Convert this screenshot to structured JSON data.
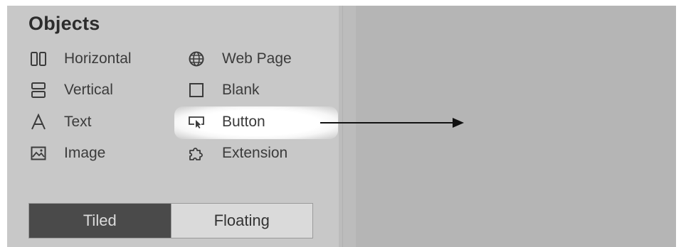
{
  "objects_panel": {
    "title": "Objects",
    "items": [
      {
        "label": "Horizontal",
        "icon": "horizontal-layout-icon"
      },
      {
        "label": "Vertical",
        "icon": "vertical-layout-icon"
      },
      {
        "label": "Text",
        "icon": "text-icon"
      },
      {
        "label": "Image",
        "icon": "image-icon"
      },
      {
        "label": "Web Page",
        "icon": "globe-icon"
      },
      {
        "label": "Blank",
        "icon": "blank-icon"
      },
      {
        "label": "Button",
        "icon": "button-icon"
      },
      {
        "label": "Extension",
        "icon": "puzzle-icon"
      }
    ],
    "highlighted_item": "Button",
    "mode_toggle": {
      "tiled": "Tiled",
      "floating": "Floating",
      "selected": "Tiled"
    }
  },
  "colors": {
    "panel_bg": "#c8c8c8",
    "canvas_bg": "#b5b5b5",
    "active_toggle": "#4a4a4a",
    "highlight": "#ffffff"
  }
}
